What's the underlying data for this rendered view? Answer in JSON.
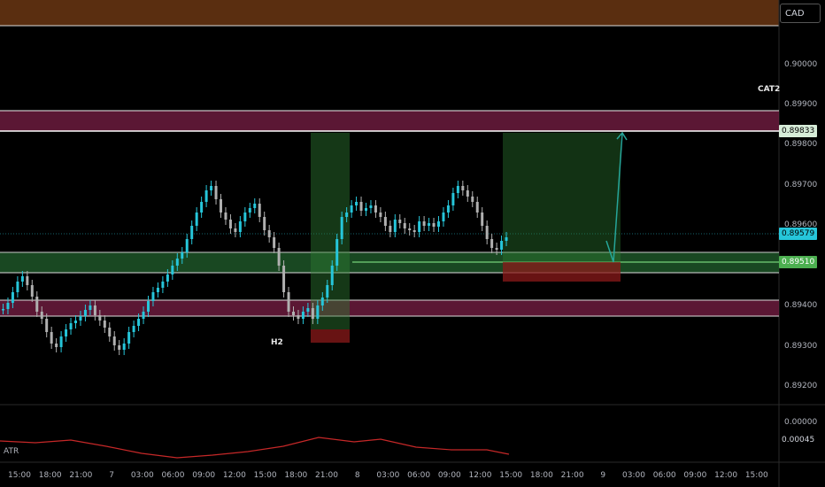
{
  "currency_button": "CAD",
  "price_ticks": [
    "0.90000",
    "0.89900",
    "0.89800",
    "0.89700",
    "0.89600",
    "0.89400",
    "0.89300",
    "0.89200",
    "0.00000"
  ],
  "price_badges": {
    "level_top": "0.89833",
    "last_price": "0.89579",
    "level_mid": "0.89510",
    "atr_value": "0.00045"
  },
  "annotations": {
    "zone_label": "CAT2",
    "timeframe_label": "H2"
  },
  "indicator_label": "ATR",
  "time_ticks": [
    "15:00",
    "18:00",
    "21:00",
    "7",
    "03:00",
    "06:00",
    "09:00",
    "12:00",
    "15:00",
    "18:00",
    "21:00",
    "8",
    "03:00",
    "06:00",
    "09:00",
    "12:00",
    "15:00",
    "18:00",
    "21:00",
    "9",
    "03:00",
    "06:00",
    "09:00",
    "12:00",
    "15:00"
  ],
  "colors": {
    "supply_zone": "#7a1f45",
    "demand_zone": "#1f5a2a",
    "top_band": "#5a2e10",
    "candle": "#26c6da",
    "last_price_badge": "#26c6da",
    "atr_line": "#c62828",
    "projection_arrow": "#26a69a"
  }
}
